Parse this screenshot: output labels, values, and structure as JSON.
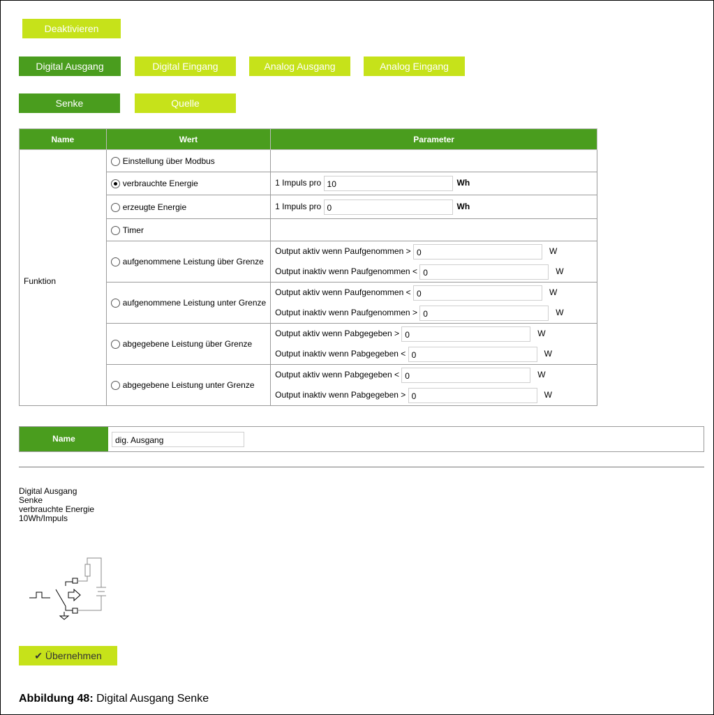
{
  "buttons": {
    "deactivate": "Deaktivieren",
    "types": [
      "Digital Ausgang",
      "Digital Eingang",
      "Analog Ausgang",
      "Analog Eingang"
    ],
    "modes": [
      "Senke",
      "Quelle"
    ]
  },
  "colors": {
    "lime": "#c6e21a",
    "green": "#4a9d1e"
  },
  "table": {
    "headers": {
      "name": "Name",
      "wert": "Wert",
      "parameter": "Parameter"
    },
    "funktion_label": "Funktion",
    "rows": [
      {
        "label": "Einstellung über Modbus",
        "selected": false
      },
      {
        "label": "verbrauchte Energie",
        "selected": true,
        "prefix": "1 Impuls pro",
        "value": "10",
        "unit": "Wh"
      },
      {
        "label": "erzeugte Energie",
        "selected": false,
        "prefix": "1 Impuls pro",
        "value": "0",
        "unit": "Wh"
      },
      {
        "label": "Timer",
        "selected": false
      },
      {
        "label": "aufgenommene Leistung über Grenze",
        "selected": false,
        "p1": "Output aktiv wenn Paufgenommen >",
        "v1": "0",
        "p2": "Output inaktiv wenn Paufgenommen <",
        "v2": "0",
        "unit": "W"
      },
      {
        "label": "aufgenommene Leistung unter Grenze",
        "selected": false,
        "p1": "Output aktiv wenn Paufgenommen <",
        "v1": "0",
        "p2": "Output inaktiv wenn Paufgenommen >",
        "v2": "0",
        "unit": "W"
      },
      {
        "label": "abgegebene Leistung über Grenze",
        "selected": false,
        "p1": "Output aktiv wenn Pabgegeben >",
        "v1": "0",
        "p2": "Output inaktiv wenn Pabgegeben <",
        "v2": "0",
        "unit": "W"
      },
      {
        "label": "abgegebene Leistung unter Grenze",
        "selected": false,
        "p1": "Output aktiv wenn Pabgegeben <",
        "v1": "0",
        "p2": "Output inaktiv wenn Pabgegeben >",
        "v2": "0",
        "unit": "W"
      }
    ]
  },
  "name_section": {
    "label": "Name",
    "value": "dig. Ausgang"
  },
  "summary": [
    "Digital Ausgang",
    "Senke",
    "verbrauchte Energie",
    "10Wh/Impuls"
  ],
  "apply_button": {
    "icon": "✔",
    "label": "Übernehmen"
  },
  "caption": {
    "bold": "Abbildung 48:",
    "text": " Digital Ausgang Senke"
  }
}
